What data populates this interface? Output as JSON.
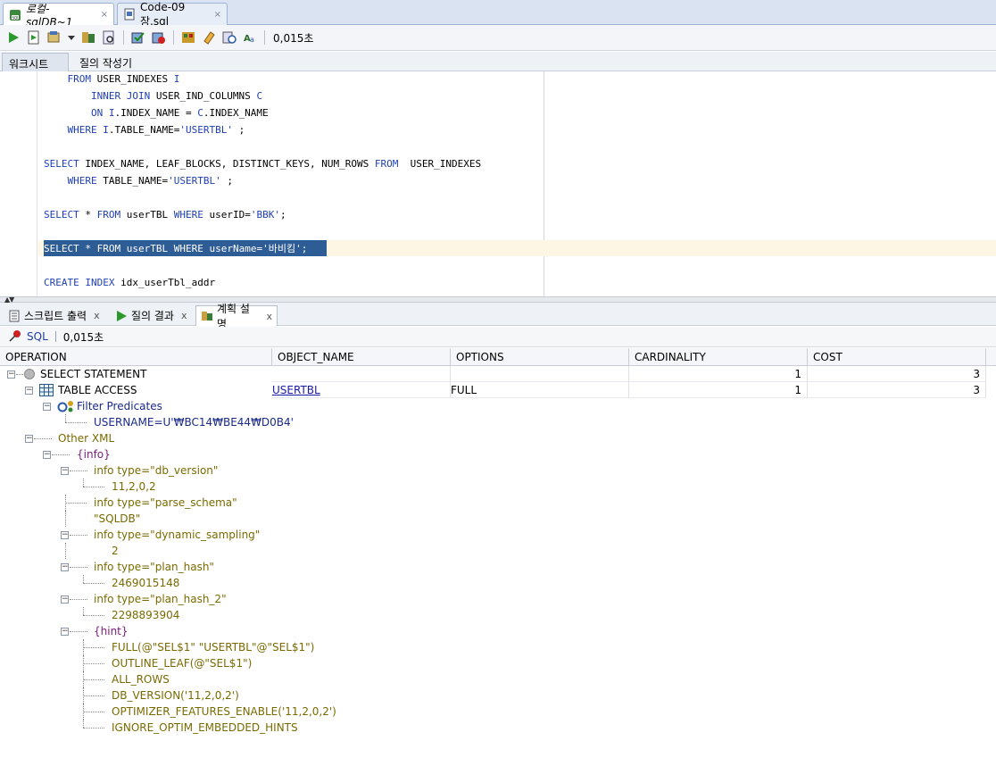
{
  "doc_tabs": [
    {
      "label": "로컬-sqlDB~1",
      "close": "×"
    },
    {
      "label": "Code-09장.sql",
      "close": "×"
    }
  ],
  "toolbar": {
    "exec_time": "0,015초"
  },
  "sub_tabs": {
    "worksheet": "워크시트",
    "query_builder": "질의 작성기"
  },
  "editor": {
    "lines": [
      [
        {
          "t": "    ",
          "c": "tx"
        },
        {
          "t": "FROM",
          "c": "kw"
        },
        {
          "t": " USER_INDEXES ",
          "c": "tx"
        },
        {
          "t": "I",
          "c": "kw"
        }
      ],
      [
        {
          "t": "        ",
          "c": "tx"
        },
        {
          "t": "INNER JOIN",
          "c": "kw"
        },
        {
          "t": " USER_IND_COLUMNS ",
          "c": "tx"
        },
        {
          "t": "C",
          "c": "kw"
        }
      ],
      [
        {
          "t": "        ",
          "c": "tx"
        },
        {
          "t": "ON",
          "c": "kw"
        },
        {
          "t": " ",
          "c": "tx"
        },
        {
          "t": "I",
          "c": "kw"
        },
        {
          "t": ".INDEX_NAME = ",
          "c": "tx"
        },
        {
          "t": "C",
          "c": "kw"
        },
        {
          "t": ".INDEX_NAME",
          "c": "tx"
        }
      ],
      [
        {
          "t": "    ",
          "c": "tx"
        },
        {
          "t": "WHERE",
          "c": "kw"
        },
        {
          "t": " ",
          "c": "tx"
        },
        {
          "t": "I",
          "c": "kw"
        },
        {
          "t": ".TABLE_NAME=",
          "c": "tx"
        },
        {
          "t": "'USERTBL'",
          "c": "str"
        },
        {
          "t": " ;",
          "c": "tx"
        }
      ],
      [],
      [
        {
          "t": "SELECT",
          "c": "kw"
        },
        {
          "t": " INDEX_NAME, LEAF_BLOCKS, DISTINCT_KEYS, NUM_ROWS ",
          "c": "tx"
        },
        {
          "t": "FROM",
          "c": "kw"
        },
        {
          "t": "  USER_INDEXES",
          "c": "tx"
        }
      ],
      [
        {
          "t": "    ",
          "c": "tx"
        },
        {
          "t": "WHERE",
          "c": "kw"
        },
        {
          "t": " TABLE_NAME=",
          "c": "tx"
        },
        {
          "t": "'USERTBL'",
          "c": "str"
        },
        {
          "t": " ;",
          "c": "tx"
        }
      ],
      [],
      [
        {
          "t": "SELECT",
          "c": "kw"
        },
        {
          "t": " * ",
          "c": "tx"
        },
        {
          "t": "FROM",
          "c": "kw"
        },
        {
          "t": " userTBL ",
          "c": "tx"
        },
        {
          "t": "WHERE",
          "c": "kw"
        },
        {
          "t": " userID=",
          "c": "tx"
        },
        {
          "t": "'BBK'",
          "c": "str"
        },
        {
          "t": ";",
          "c": "tx"
        }
      ],
      [],
      [
        {
          "t": "SELECT",
          "c": "kw"
        },
        {
          "t": " * ",
          "c": "tx"
        },
        {
          "t": "FROM",
          "c": "kw"
        },
        {
          "t": " userTBL ",
          "c": "tx"
        },
        {
          "t": "WHERE",
          "c": "kw"
        },
        {
          "t": " userName=",
          "c": "tx"
        },
        {
          "t": "'바비킴'",
          "c": "str"
        },
        {
          "t": ";",
          "c": "tx"
        }
      ],
      [],
      [
        {
          "t": "CREATE",
          "c": "kw"
        },
        {
          "t": " ",
          "c": "tx"
        },
        {
          "t": "INDEX",
          "c": "kw"
        },
        {
          "t": " idx_userTbl_addr",
          "c": "tx"
        }
      ]
    ]
  },
  "bottom_tabs": [
    {
      "label": "스크립트 출력",
      "close": "x"
    },
    {
      "label": "질의 결과",
      "close": "x"
    },
    {
      "label": "계획 설명",
      "close": "x"
    }
  ],
  "result_toolbar": {
    "sql_label": "SQL",
    "time": "0,015초"
  },
  "plan_columns": [
    "OPERATION",
    "OBJECT_NAME",
    "OPTIONS",
    "CARDINALITY",
    "COST"
  ],
  "plan_rows": [
    {
      "op": "SELECT STATEMENT",
      "object": "",
      "options": "",
      "cardinality": "1",
      "cost": "3"
    },
    {
      "op": "TABLE ACCESS",
      "object": "USERTBL",
      "options": "FULL",
      "cardinality": "1",
      "cost": "3"
    }
  ],
  "plan_tree": [
    {
      "text": "Filter Predicates",
      "cls": "darkblue"
    },
    {
      "text": "USERNAME=U'₩BC14₩BE44₩D0B4'",
      "cls": "darkblue"
    },
    {
      "text": "Other XML",
      "cls": "olive"
    },
    {
      "text": "{info}",
      "cls": "purple"
    },
    {
      "text": "info type=\"db_version\"",
      "cls": "olive"
    },
    {
      "text": "11,2,0,2",
      "cls": "olive"
    },
    {
      "text": "info type=\"parse_schema\"",
      "cls": "olive"
    },
    {
      "text": "\"SQLDB\"",
      "cls": "olive"
    },
    {
      "text": "info type=\"dynamic_sampling\"",
      "cls": "olive"
    },
    {
      "text": "2",
      "cls": "olive"
    },
    {
      "text": "info type=\"plan_hash\"",
      "cls": "olive"
    },
    {
      "text": "2469015148",
      "cls": "olive"
    },
    {
      "text": "info type=\"plan_hash_2\"",
      "cls": "olive"
    },
    {
      "text": "2298893904",
      "cls": "olive"
    },
    {
      "text": "{hint}",
      "cls": "purple"
    },
    {
      "text": "FULL(@\"SEL$1\" \"USERTBL\"@\"SEL$1\")",
      "cls": "olive"
    },
    {
      "text": "OUTLINE_LEAF(@\"SEL$1\")",
      "cls": "olive"
    },
    {
      "text": "ALL_ROWS",
      "cls": "olive"
    },
    {
      "text": "DB_VERSION('11,2,0,2')",
      "cls": "olive"
    },
    {
      "text": "OPTIMIZER_FEATURES_ENABLE('11,2,0,2')",
      "cls": "olive"
    },
    {
      "text": "IGNORE_OPTIM_EMBEDDED_HINTS",
      "cls": "olive"
    }
  ]
}
